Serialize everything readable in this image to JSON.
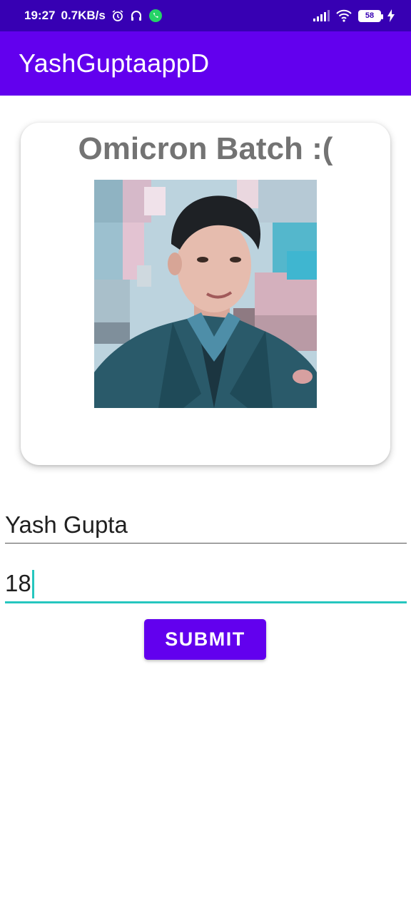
{
  "status_bar": {
    "time": "19:27",
    "net_speed": "0.7KB/s",
    "battery": "58",
    "icons": [
      "alarm-icon",
      "headphones-icon",
      "whatsapp-icon",
      "signal-icon",
      "wifi-icon",
      "battery-icon",
      "charging-icon"
    ]
  },
  "app_bar": {
    "title": "YashGuptaappD",
    "color": "#6200ee"
  },
  "card": {
    "title": "Omicron Batch :("
  },
  "form": {
    "name_value": "Yash Gupta",
    "age_value": "18",
    "submit_label": "SUBMIT"
  },
  "colors": {
    "status_bar": "#3700b3",
    "primary": "#6200ee",
    "accent": "#26c6bf",
    "card_title": "#737373"
  }
}
